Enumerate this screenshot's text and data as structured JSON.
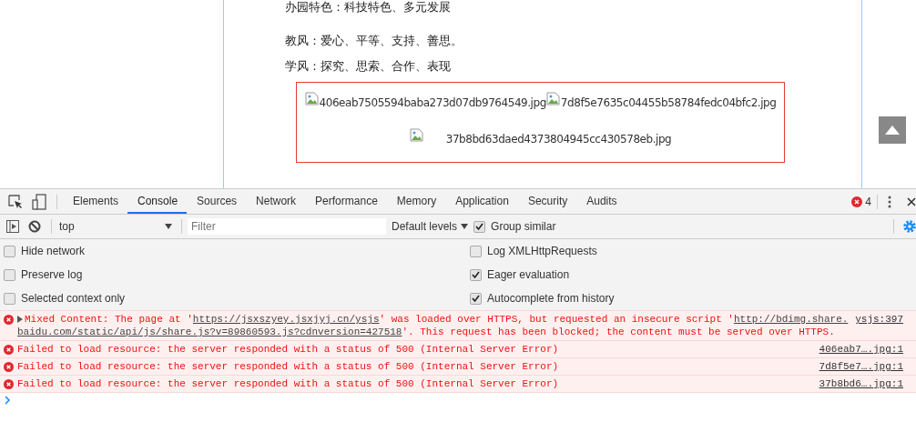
{
  "page": {
    "paragraphs": [
      "办园特色：科技特色、多元发展",
      "教风：爱心、平等、支持、善思。",
      "学风：探究、思索、合作、表现"
    ],
    "image_rows": [
      [
        {
          "alt": "406eab7505594baba273d07db9764549.jpg"
        },
        {
          "alt": "7d8f5e7635c04455b58784fedc04bfc2.jpg"
        }
      ],
      [
        {
          "alt": "37b8bd63daed4373804945cc430578eb.jpg"
        }
      ]
    ]
  },
  "devtools": {
    "tabs": [
      {
        "label": "Elements",
        "selected": false
      },
      {
        "label": "Console",
        "selected": true
      },
      {
        "label": "Sources",
        "selected": false
      },
      {
        "label": "Network",
        "selected": false
      },
      {
        "label": "Performance",
        "selected": false
      },
      {
        "label": "Memory",
        "selected": false
      },
      {
        "label": "Application",
        "selected": false
      },
      {
        "label": "Security",
        "selected": false
      },
      {
        "label": "Audits",
        "selected": false
      }
    ],
    "error_count": "4",
    "toolbar": {
      "context": "top",
      "filter_placeholder": "Filter",
      "levels": "Default levels",
      "group_similar": {
        "label": "Group similar",
        "checked": true
      }
    },
    "settings": [
      {
        "label": "Hide network",
        "checked": false
      },
      {
        "label": "Log XMLHttpRequests",
        "checked": false
      },
      {
        "label": "Preserve log",
        "checked": false
      },
      {
        "label": "Eager evaluation",
        "checked": true
      },
      {
        "label": "Selected context only",
        "checked": false
      },
      {
        "label": "Autocomplete from history",
        "checked": true
      }
    ],
    "messages": [
      {
        "expandable": true,
        "source": "ysjs:397",
        "lines": [
          [
            {
              "kind": "text",
              "text": "Mixed Content: The page at '"
            },
            {
              "kind": "link",
              "text": "https://jsxszyey.jsxjyj.cn/ysjs"
            },
            {
              "kind": "text",
              "text": "' was loaded over HTTPS, but requested an insecure script '"
            },
            {
              "kind": "link",
              "text": "http://bdimg.share."
            }
          ],
          [
            {
              "kind": "link",
              "text": "baidu.com/static/api/js/share.js?v=89860593.js?cdnversion=427518"
            },
            {
              "kind": "text",
              "text": "'. This request has been blocked; the content must be served over HTTPS."
            }
          ]
        ]
      },
      {
        "expandable": false,
        "source": "406eab7….jpg:1",
        "lines": [
          [
            {
              "kind": "text",
              "text": "Failed to load resource: the server responded with a status of 500 (Internal Server Error)"
            }
          ]
        ]
      },
      {
        "expandable": false,
        "source": "7d8f5e7….jpg:1",
        "lines": [
          [
            {
              "kind": "text",
              "text": "Failed to load resource: the server responded with a status of 500 (Internal Server Error)"
            }
          ]
        ]
      },
      {
        "expandable": false,
        "source": "37b8bd6….jpg:1",
        "lines": [
          [
            {
              "kind": "text",
              "text": "Failed to load resource: the server responded with a status of 500 (Internal Server Error)"
            }
          ]
        ]
      }
    ]
  }
}
